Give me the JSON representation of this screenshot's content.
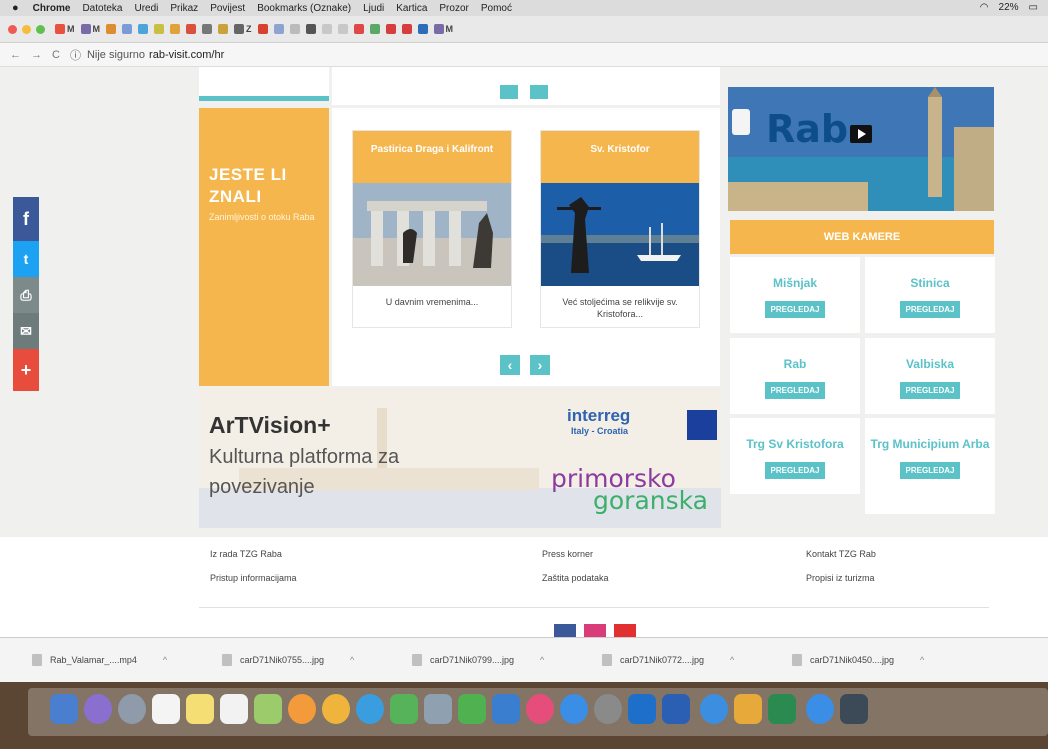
{
  "menubar": {
    "apple": "●",
    "items": [
      "Chrome",
      "Datoteka",
      "Uredi",
      "Prikaz",
      "Povijest",
      "Bookmarks (Oznake)",
      "Ljudi",
      "Kartica",
      "Prozor",
      "Pomoć"
    ],
    "battery": "22%"
  },
  "tabs": [
    "M",
    "M",
    "Z",
    "M"
  ],
  "address": {
    "insecure": "Nije sigurno",
    "host": "rab-visit.com/hr"
  },
  "social": {
    "facebook": "f",
    "twitter": "t",
    "print": "⎙",
    "email": "✉",
    "plus": "+"
  },
  "jeste_li_znali": {
    "title_line1": "JESTE LI",
    "title_line2": "ZNALI",
    "subtitle": "Zanimljivosti o otoku Raba"
  },
  "cards": [
    {
      "title": "Pastirica Draga i Kalifront",
      "caption": "U davnim vremenima..."
    },
    {
      "title": "Sv. Kristofor",
      "caption": "Već stoljećima se relikvije sv. Kristofora..."
    }
  ],
  "carousel": {
    "prev": "‹",
    "next": "›"
  },
  "video": {
    "title": "Rab"
  },
  "web_kamere": {
    "heading": "WEB KAMERE",
    "cameras": [
      {
        "name": "Mišnjak",
        "button": "PREGLEDAJ"
      },
      {
        "name": "Stinica",
        "button": "PREGLEDAJ"
      },
      {
        "name": "Rab",
        "button": "PREGLEDAJ"
      },
      {
        "name": "Valbiska",
        "button": "PREGLEDAJ"
      },
      {
        "name": "Trg Sv Kristofora",
        "button": "PREGLEDAJ"
      },
      {
        "name": "Trg Municipium Arba",
        "button": "PREGLEDAJ"
      }
    ]
  },
  "banner": {
    "title": "ArTVision+",
    "line2": "Kulturna platforma za",
    "line3": "povezivanje",
    "interreg": "interreg",
    "interreg_sub": "Italy - Croatia",
    "pgz_top": "primorsko",
    "pgz_bottom": "goranska"
  },
  "footer": {
    "links": [
      "Iz rada TZG Raba",
      "Pristup informacijama",
      "Press korner",
      "Zaštita podataka",
      "Kontakt TZG Rab",
      "Propisi iz turizma"
    ]
  },
  "downloads": [
    "Rab_Valamar_....mp4",
    "carD71Nik0755....jpg",
    "carD71Nik0799....jpg",
    "carD71Nik0772....jpg",
    "carD71Nik0450....jpg"
  ],
  "colors": {
    "accent_orange": "#f5b64e",
    "accent_teal": "#5bc2c8",
    "facebook": "#3b5998",
    "twitter": "#1da1f2",
    "print": "#7c8a8a",
    "email": "#6d7b7b",
    "plus": "#e84c3d"
  }
}
